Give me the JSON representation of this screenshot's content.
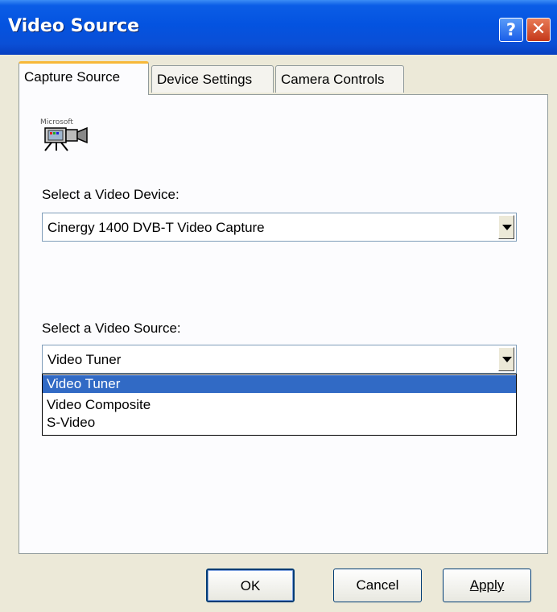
{
  "window": {
    "title": "Video Source"
  },
  "titlebar_buttons": {
    "help": "?",
    "close": "✕"
  },
  "tabs": [
    {
      "label": "Capture Source",
      "active": true
    },
    {
      "label": "Device Settings",
      "active": false
    },
    {
      "label": "Camera Controls",
      "active": false
    }
  ],
  "icon": {
    "name": "video-camera-icon",
    "brand_text": "Microsoft"
  },
  "video_device": {
    "label": "Select a Video Device:",
    "value": "Cinergy 1400 DVB-T Video Capture"
  },
  "video_source": {
    "label": "Select a Video Source:",
    "value": "Video Tuner",
    "options": [
      "Video Tuner",
      "Video Composite",
      "S-Video"
    ],
    "selected_index": 0
  },
  "buttons": {
    "ok": "OK",
    "cancel": "Cancel",
    "apply": "Apply"
  },
  "colors": {
    "titlebar": "#0453e0",
    "selection": "#316ac5",
    "active_tab_accent": "#f7b838"
  }
}
